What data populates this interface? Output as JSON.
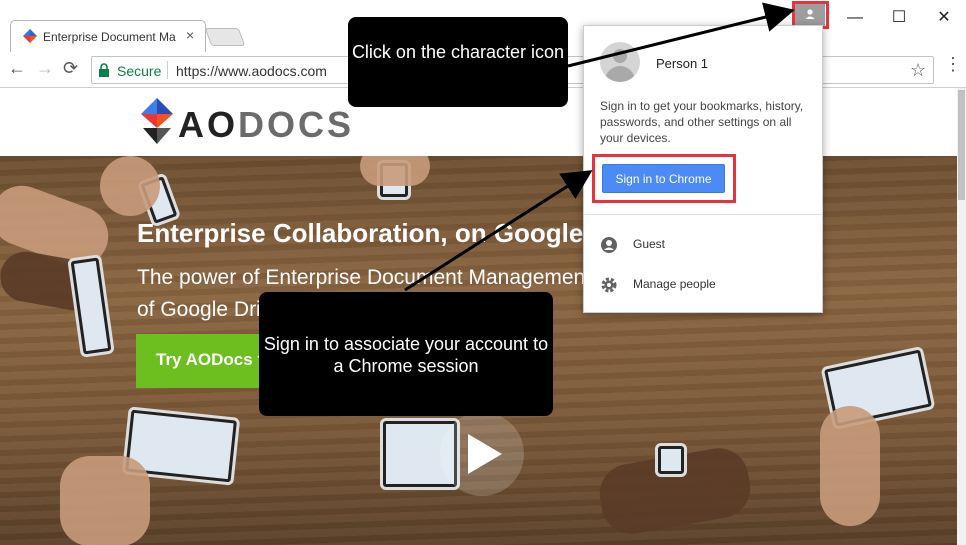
{
  "tab": {
    "title": "Enterprise Document Ma",
    "close_glyph": "×"
  },
  "window": {
    "minimize": "—",
    "maximize": "☐",
    "close": "✕"
  },
  "toolbar": {
    "back": "←",
    "forward": "→",
    "reload": "⟳",
    "secure_label": "Secure",
    "url": "https://www.aodocs.com",
    "star": "☆",
    "menu": "⋮"
  },
  "site": {
    "logo_ao": "AO",
    "logo_docs": "DOCS",
    "hero_title": "Enterprise Collaboration, on Google",
    "hero_sub_1": "The power of Enterprise Document Managemen",
    "hero_sub_2": "of Google Dri",
    "cta": "Try AODocs fo"
  },
  "popup": {
    "person_name": "Person 1",
    "description": "Sign in to get your bookmarks, history, passwords, and other settings on all your devices.",
    "signin_button": "Sign in to Chrome",
    "items": [
      {
        "label": "Guest",
        "icon": "person-circle-icon"
      },
      {
        "label": "Manage people",
        "icon": "gear-icon"
      }
    ]
  },
  "callouts": {
    "character_icon": "Click on the character icon",
    "signin": "Sign in to associate your account to a Chrome session"
  },
  "colors": {
    "highlight_red": "#e5343d",
    "signin_blue": "#4c8bf5",
    "cta_green": "#6cbf1f",
    "secure_green": "#0b8043"
  }
}
